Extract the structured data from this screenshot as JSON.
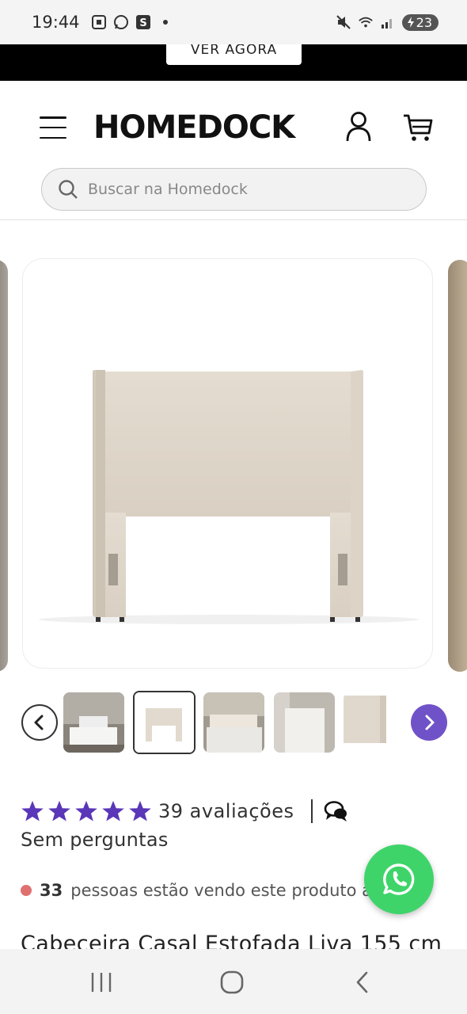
{
  "status_bar": {
    "time": "19:44",
    "battery": "23",
    "icons_left": [
      "screenshot-icon",
      "whatsapp-icon",
      "s-app-icon",
      "dot-icon"
    ],
    "icons_right": [
      "mute-icon",
      "wifi-icon",
      "signal-icon",
      "battery-icon"
    ]
  },
  "promo": {
    "button_label": "VER AGORA"
  },
  "header": {
    "logo": "HOMEDOCK",
    "search_placeholder": "Buscar na Homedock"
  },
  "gallery": {
    "main_image_alt": "Cabeceira estofada bege",
    "thumbnail_count": 5,
    "active_thumbnail": 2
  },
  "product": {
    "rating_stars": 5,
    "reviews_label": "39 avaliações",
    "questions_label": "Sem perguntas",
    "viewers_count": "33",
    "viewers_text": "pessoas estão vendo este produto agora",
    "title": "Cabeceira Casal Estofada Liva 155 cm"
  },
  "colors": {
    "accent": "#7052c8",
    "star": "#5a36b8",
    "whatsapp": "#3fd46a",
    "promo_bg": "#000000"
  }
}
